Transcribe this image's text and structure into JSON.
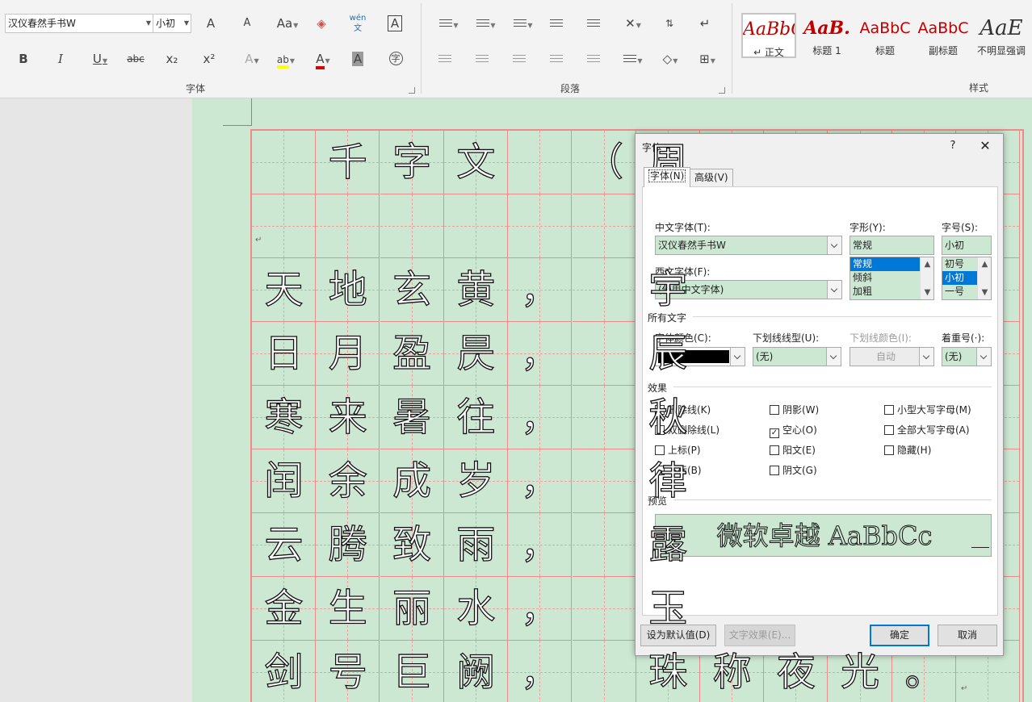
{
  "ribbon": {
    "font_name": "汉仪春然手书W",
    "font_size": "小初",
    "group_font_label": "字体",
    "group_paragraph_label": "段落",
    "group_styles_label": "样式",
    "buttons": {
      "grow": "A",
      "shrink": "A",
      "case": "Aa",
      "pinyin": "wén文",
      "border_char": "A",
      "bold": "B",
      "italic": "I",
      "underline": "U",
      "strike": "abc",
      "sub": "x₂",
      "sup": "x²",
      "text_effect": "A",
      "highlight": "ab",
      "font_color": "A",
      "shade": "A",
      "enclose": "字"
    },
    "styles": [
      {
        "sample": "AaBbC",
        "name": "↵ 正文",
        "color": "#c00000"
      },
      {
        "sample": "AaB.",
        "name": "标题 1",
        "color": "#c00000"
      },
      {
        "sample": "AaBbC",
        "name": "标题",
        "color": "#c00000"
      },
      {
        "sample": "AaBbC",
        "name": "副标题",
        "color": "#c00000"
      },
      {
        "sample": "AaE",
        "name": "不明显强调",
        "color": "#333333"
      }
    ]
  },
  "document": {
    "rows": [
      [
        "",
        "千",
        "字",
        "文",
        "",
        "（",
        "周",
        "",
        "",
        "",
        "",
        ""
      ],
      [
        "",
        "",
        "",
        "",
        "",
        "",
        "",
        "",
        "",
        "",
        "",
        ""
      ],
      [
        "天",
        "地",
        "玄",
        "黄",
        "，",
        "",
        "宇",
        "",
        "",
        "",
        "",
        ""
      ],
      [
        "日",
        "月",
        "盈",
        "昃",
        "，",
        "",
        "辰",
        "",
        "",
        "",
        "",
        ""
      ],
      [
        "寒",
        "来",
        "暑",
        "往",
        "，",
        "",
        "秋",
        "",
        "",
        "",
        "",
        ""
      ],
      [
        "闰",
        "余",
        "成",
        "岁",
        "，",
        "",
        "律",
        "",
        "",
        "",
        "",
        ""
      ],
      [
        "云",
        "腾",
        "致",
        "雨",
        "，",
        "",
        "露",
        "",
        "",
        "",
        "",
        ""
      ],
      [
        "金",
        "生",
        "丽",
        "水",
        "，",
        "",
        "玉",
        "",
        "",
        "",
        "",
        ""
      ],
      [
        "剑",
        "号",
        "巨",
        "阙",
        "，",
        "",
        "珠",
        "称",
        "夜",
        "光",
        "。",
        ""
      ]
    ],
    "paragraph_mark": "↵"
  },
  "dialog": {
    "title": "字体",
    "help": "?",
    "close": "✕",
    "tabs": [
      "字体(N)",
      "高级(V)"
    ],
    "chinese_font_label": "中文字体(T):",
    "chinese_font_value": "汉仪春然手书W",
    "western_font_label": "西文字体(F):",
    "western_font_value": "(使用中文字体)",
    "style_label": "字形(Y):",
    "style_value": "常规",
    "style_options": [
      "常规",
      "倾斜",
      "加粗"
    ],
    "size_label": "字号(S):",
    "size_value": "小初",
    "size_options": [
      "初号",
      "小初",
      "一号"
    ],
    "all_text_label": "所有文字",
    "font_color_label": "字体颜色(C):",
    "font_color_value": "#000000",
    "underline_style_label": "下划线线型(U):",
    "underline_style_value": "(无)",
    "underline_color_label": "下划线颜色(I):",
    "underline_color_value": "自动",
    "emphasis_label": "着重号(·):",
    "emphasis_value": "(无)",
    "effects_label": "效果",
    "effects": [
      {
        "label": "删除线(K)",
        "checked": false
      },
      {
        "label": "双删除线(L)",
        "checked": false
      },
      {
        "label": "上标(P)",
        "checked": false
      },
      {
        "label": "下标(B)",
        "checked": false
      },
      {
        "label": "阴影(W)",
        "checked": false
      },
      {
        "label": "空心(O)",
        "checked": true
      },
      {
        "label": "阳文(E)",
        "checked": false
      },
      {
        "label": "阴文(G)",
        "checked": false
      },
      {
        "label": "小型大写字母(M)",
        "checked": false
      },
      {
        "label": "全部大写字母(A)",
        "checked": false
      },
      {
        "label": "隐藏(H)",
        "checked": false
      }
    ],
    "preview_label": "预览",
    "preview_text": "微软卓越  AaBbCc",
    "buttons": {
      "set_default": "设为默认值(D)",
      "text_effects": "文字效果(E)...",
      "ok": "确定",
      "cancel": "取消"
    }
  }
}
